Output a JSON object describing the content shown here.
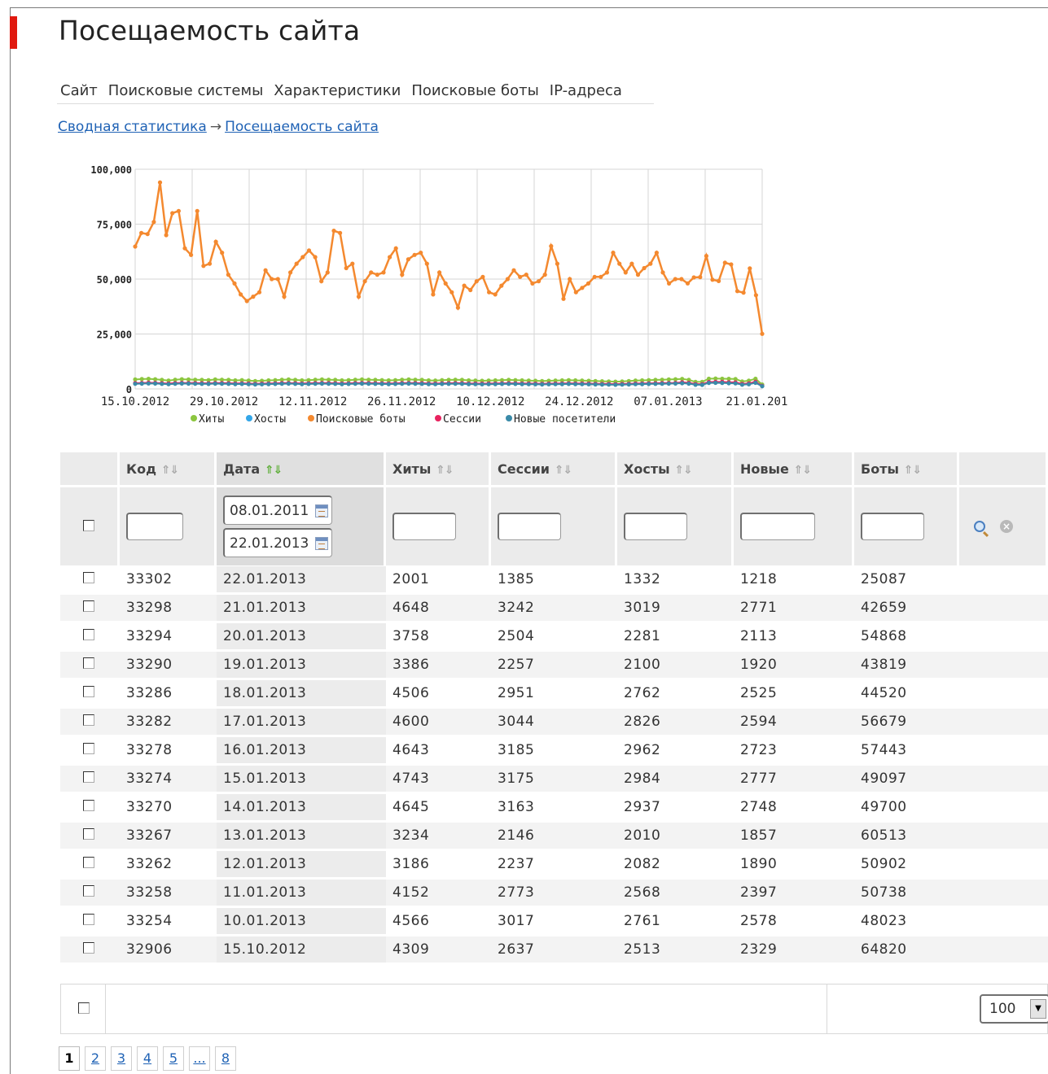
{
  "page": {
    "title": "Посещаемость сайта"
  },
  "tabs": [
    "Сайт",
    "Поисковые системы",
    "Характеристики",
    "Поисковые боты",
    "IP-адреса"
  ],
  "breadcrumb": {
    "root": "Сводная статистика",
    "arrow": "→",
    "current": "Посещаемость сайта"
  },
  "chart_data": {
    "type": "line",
    "title": "",
    "xlabel": "",
    "ylabel": "",
    "ylim": [
      0,
      100000
    ],
    "yticks": [
      "0",
      "25,000",
      "50,000",
      "75,000",
      "100,000"
    ],
    "xticks": [
      "15.10.2012",
      "29.10.2012",
      "12.11.2012",
      "26.11.2012",
      "10.12.2012",
      "24.12.2012",
      "07.01.2013",
      "21.01.201"
    ],
    "x_range": [
      "15.10.2012",
      "22.01.2013"
    ],
    "grid": true,
    "legend_position": "bottom",
    "series": [
      {
        "name": "Хиты",
        "color": "#8cc63f",
        "values": [
          4309,
          4500,
          4600,
          4400,
          4100,
          3800,
          4200,
          4400,
          4300,
          4200,
          4100,
          4000,
          4300,
          4200,
          4100,
          3900,
          4000,
          3800,
          3600,
          3700,
          3900,
          4000,
          4200,
          4300,
          4100,
          3900,
          4000,
          4200,
          4300,
          4200,
          4100,
          3900,
          4000,
          4200,
          4300,
          4200,
          4100,
          4000,
          3900,
          4000,
          4200,
          4300,
          4200,
          4100,
          3900,
          3800,
          4000,
          4100,
          4200,
          4100,
          3900,
          3800,
          3700,
          3800,
          3900,
          4000,
          4100,
          4000,
          3900,
          3800,
          3700,
          3600,
          3700,
          3800,
          3900,
          4000,
          3900,
          3800,
          3700,
          3600,
          3500,
          3400,
          3300,
          3400,
          3600,
          3800,
          3900,
          4000,
          4100,
          4200,
          4300,
          4400,
          4566,
          4152,
          3186,
          3234,
          4645,
          4743,
          4643,
          4600,
          4506,
          3386,
          3758,
          4648,
          2001
        ]
      },
      {
        "name": "Хосты",
        "color": "#33a6e8",
        "values": [
          2513,
          2600,
          2700,
          2650,
          2500,
          2350,
          2550,
          2650,
          2600,
          2550,
          2500,
          2450,
          2600,
          2550,
          2500,
          2400,
          2450,
          2350,
          2250,
          2300,
          2400,
          2450,
          2550,
          2600,
          2500,
          2400,
          2450,
          2550,
          2600,
          2550,
          2500,
          2400,
          2450,
          2550,
          2600,
          2550,
          2500,
          2450,
          2400,
          2450,
          2550,
          2600,
          2550,
          2500,
          2400,
          2350,
          2450,
          2500,
          2550,
          2500,
          2400,
          2350,
          2300,
          2350,
          2400,
          2450,
          2500,
          2450,
          2400,
          2350,
          2300,
          2250,
          2300,
          2350,
          2400,
          2450,
          2400,
          2350,
          2300,
          2250,
          2200,
          2150,
          2100,
          2150,
          2250,
          2350,
          2400,
          2450,
          2500,
          2550,
          2600,
          2650,
          2761,
          2568,
          2082,
          2010,
          2937,
          2984,
          2962,
          2826,
          2762,
          2100,
          2281,
          3019,
          1332
        ]
      },
      {
        "name": "Поисковые боты",
        "color": "#f4892f",
        "values": [
          64820,
          71000,
          70500,
          76000,
          94000,
          70000,
          80000,
          81000,
          64000,
          61000,
          81000,
          56000,
          57000,
          67000,
          62000,
          52000,
          48000,
          43000,
          40000,
          42000,
          44000,
          54000,
          50000,
          50000,
          42000,
          53000,
          57000,
          60000,
          63000,
          60000,
          49000,
          53000,
          72000,
          71000,
          55000,
          57000,
          42000,
          49000,
          53000,
          52000,
          53000,
          60000,
          64000,
          52000,
          59000,
          61000,
          62000,
          57000,
          43000,
          53000,
          48000,
          44000,
          37000,
          47000,
          45000,
          49000,
          51000,
          44000,
          43000,
          47000,
          50000,
          54000,
          51000,
          52000,
          48000,
          49000,
          52000,
          65000,
          57000,
          41000,
          50000,
          44000,
          46000,
          48000,
          51000,
          51000,
          53000,
          62000,
          57000,
          53000,
          57000,
          52000,
          55000,
          57000,
          62000,
          53000,
          48000,
          50000,
          50000,
          48023,
          50738,
          50902,
          60513,
          49700,
          49097,
          57443,
          56679,
          44520,
          43819,
          54868,
          42659,
          25087
        ]
      },
      {
        "name": "Сессии",
        "color": "#e8235f",
        "values": [
          2637,
          2700,
          2800,
          2750,
          2600,
          2450,
          2650,
          2750,
          2700,
          2650,
          2600,
          2550,
          2700,
          2650,
          2600,
          2500,
          2550,
          2450,
          2350,
          2400,
          2500,
          2550,
          2650,
          2700,
          2600,
          2500,
          2550,
          2650,
          2700,
          2650,
          2600,
          2500,
          2550,
          2650,
          2700,
          2650,
          2600,
          2550,
          2500,
          2550,
          2650,
          2700,
          2650,
          2600,
          2500,
          2450,
          2550,
          2600,
          2650,
          2600,
          2500,
          2450,
          2400,
          2450,
          2500,
          2550,
          2600,
          2550,
          2500,
          2450,
          2400,
          2350,
          2400,
          2450,
          2500,
          2550,
          2500,
          2450,
          2400,
          2350,
          2300,
          2250,
          2200,
          2250,
          2350,
          2450,
          2500,
          2550,
          2600,
          2650,
          2700,
          2750,
          3017,
          2773,
          2237,
          2146,
          3163,
          3175,
          3185,
          3044,
          2951,
          2257,
          2504,
          3242,
          1385
        ]
      },
      {
        "name": "Новые посетители",
        "color": "#3a8aa8",
        "values": [
          2329,
          2400,
          2500,
          2450,
          2300,
          2150,
          2350,
          2450,
          2400,
          2350,
          2300,
          2250,
          2400,
          2350,
          2300,
          2200,
          2250,
          2150,
          2050,
          2100,
          2200,
          2250,
          2350,
          2400,
          2300,
          2200,
          2250,
          2350,
          2400,
          2350,
          2300,
          2200,
          2250,
          2350,
          2400,
          2350,
          2300,
          2250,
          2200,
          2250,
          2350,
          2400,
          2350,
          2300,
          2200,
          2150,
          2250,
          2300,
          2350,
          2300,
          2200,
          2150,
          2100,
          2150,
          2200,
          2250,
          2300,
          2250,
          2200,
          2150,
          2100,
          2050,
          2100,
          2150,
          2200,
          2250,
          2200,
          2150,
          2100,
          2050,
          2000,
          1950,
          1900,
          1950,
          2050,
          2150,
          2200,
          2250,
          2300,
          2350,
          2400,
          2450,
          2578,
          2397,
          1890,
          1857,
          2748,
          2777,
          2723,
          2594,
          2525,
          1920,
          2113,
          2771,
          1218
        ]
      }
    ]
  },
  "table": {
    "columns": [
      {
        "label": "Код"
      },
      {
        "label": "Дата",
        "active": true
      },
      {
        "label": "Хиты"
      },
      {
        "label": "Сессии"
      },
      {
        "label": "Хосты"
      },
      {
        "label": "Новые"
      },
      {
        "label": "Боты"
      }
    ],
    "sort_arrows": "⇑⇓",
    "filter": {
      "date_from": "08.01.2011",
      "date_to": "22.01.2013"
    },
    "rows": [
      [
        "33302",
        "22.01.2013",
        "2001",
        "1385",
        "1332",
        "1218",
        "25087"
      ],
      [
        "33298",
        "21.01.2013",
        "4648",
        "3242",
        "3019",
        "2771",
        "42659"
      ],
      [
        "33294",
        "20.01.2013",
        "3758",
        "2504",
        "2281",
        "2113",
        "54868"
      ],
      [
        "33290",
        "19.01.2013",
        "3386",
        "2257",
        "2100",
        "1920",
        "43819"
      ],
      [
        "33286",
        "18.01.2013",
        "4506",
        "2951",
        "2762",
        "2525",
        "44520"
      ],
      [
        "33282",
        "17.01.2013",
        "4600",
        "3044",
        "2826",
        "2594",
        "56679"
      ],
      [
        "33278",
        "16.01.2013",
        "4643",
        "3185",
        "2962",
        "2723",
        "57443"
      ],
      [
        "33274",
        "15.01.2013",
        "4743",
        "3175",
        "2984",
        "2777",
        "49097"
      ],
      [
        "33270",
        "14.01.2013",
        "4645",
        "3163",
        "2937",
        "2748",
        "49700"
      ],
      [
        "33267",
        "13.01.2013",
        "3234",
        "2146",
        "2010",
        "1857",
        "60513"
      ],
      [
        "33262",
        "12.01.2013",
        "3186",
        "2237",
        "2082",
        "1890",
        "50902"
      ],
      [
        "33258",
        "11.01.2013",
        "4152",
        "2773",
        "2568",
        "2397",
        "50738"
      ],
      [
        "33254",
        "10.01.2013",
        "4566",
        "3017",
        "2761",
        "2578",
        "48023"
      ],
      [
        "32906",
        "15.10.2012",
        "4309",
        "2637",
        "2513",
        "2329",
        "64820"
      ]
    ]
  },
  "footer": {
    "page_size": "100"
  },
  "pager": {
    "pages": [
      "1",
      "2",
      "3",
      "4",
      "5",
      "...",
      "8"
    ],
    "current": "1"
  }
}
